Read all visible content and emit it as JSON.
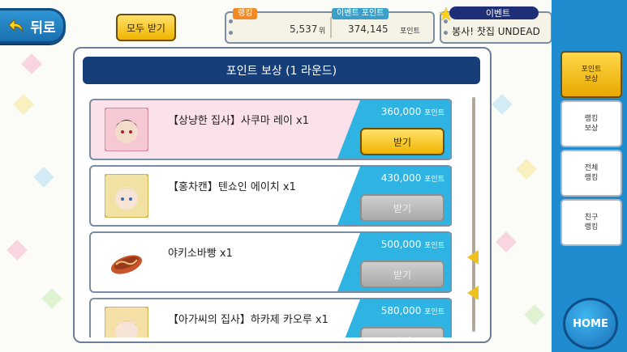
{
  "header": {
    "back_label": "뒤로",
    "claim_all_label": "모두 받기"
  },
  "stats": {
    "ranking_label": "랭킹",
    "ranking_value": "5,537",
    "ranking_unit": "위",
    "event_points_label": "이벤트 포인트",
    "event_points_value": "374,145",
    "event_points_unit": "포인트"
  },
  "event": {
    "tag": "이벤트",
    "name": "봉사! 찻집 UNDEAD"
  },
  "panel": {
    "title": "포인트 보상 (1 라운드)"
  },
  "rewards": [
    {
      "title": "【상냥한 집사】사쿠마 레이 x1",
      "points": "360,000",
      "unit": "포인트",
      "button": "받기",
      "state": "on",
      "thumb": "card-portrait-rei"
    },
    {
      "title": "【홍차캔】텐쇼인 에이치 x1",
      "points": "430,000",
      "unit": "포인트",
      "button": "받기",
      "state": "off",
      "thumb": "card-portrait-eichi"
    },
    {
      "title": "야키소바빵 x1",
      "points": "500,000",
      "unit": "포인트",
      "button": "받기",
      "state": "off",
      "thumb": "yakisoba-bread-icon"
    },
    {
      "title": "【아가씨의 집사】하카제 카오루 x1",
      "points": "580,000",
      "unit": "포인트",
      "button": "받기",
      "state": "off",
      "thumb": "card-portrait-kaoru"
    }
  ],
  "side_tabs": [
    {
      "label": "포인트\n보상",
      "active": true
    },
    {
      "label": "랭킹\n보상",
      "active": false
    },
    {
      "label": "전체\n랭킹",
      "active": false
    },
    {
      "label": "친구\n랭킹",
      "active": false
    }
  ],
  "home_label": "HOME",
  "colors": {
    "accent_blue": "#2fb3e2",
    "header_navy": "#163f7a",
    "button_gold": "#f0b400",
    "sidebar_blue": "#1f8cd0"
  }
}
